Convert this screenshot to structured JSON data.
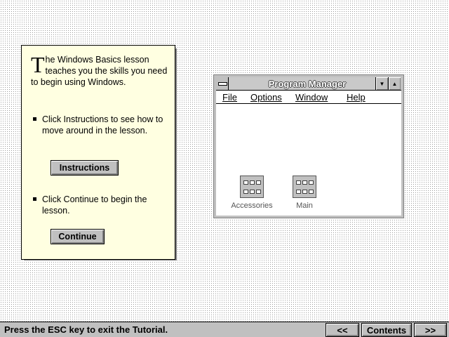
{
  "lesson": {
    "dropcap": "T",
    "intro": "he Windows Basics lesson teaches you the skills you need to begin using Windows.",
    "bullet_instructions": "Click Instructions to see how to move around in the lesson.",
    "instructions_button": "Instructions",
    "bullet_continue": "Click Continue to begin the lesson.",
    "continue_button": "Continue"
  },
  "program_manager": {
    "title": "Program Manager",
    "menu": [
      "File",
      "Options",
      "Window",
      "Help"
    ],
    "icons": [
      {
        "label": "Accessories"
      },
      {
        "label": "Main"
      }
    ]
  },
  "statusbar": {
    "message": "Press the ESC key to exit the Tutorial.",
    "prev_label": "<<",
    "contents_label": "Contents",
    "next_label": ">>"
  }
}
